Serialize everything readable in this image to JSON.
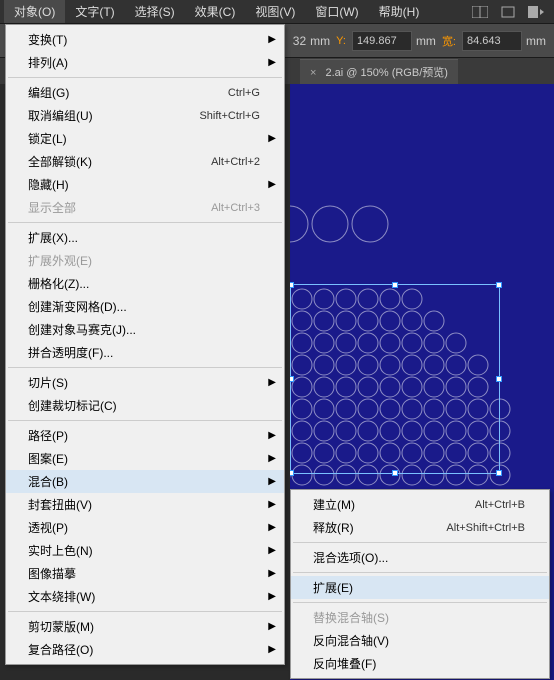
{
  "menubar": {
    "items": [
      "对象(O)",
      "文字(T)",
      "选择(S)",
      "效果(C)",
      "视图(V)",
      "窗口(W)",
      "帮助(H)"
    ]
  },
  "toolbar": {
    "x_value": "32",
    "x_unit": "mm",
    "y_label": "Y:",
    "y_value": "149.867",
    "y_unit": "mm",
    "w_label": "宽:",
    "w_value": "84.643",
    "w_unit": "mm"
  },
  "tab": {
    "close": "×",
    "title": "2.ai @ 150% (RGB/预览)"
  },
  "menu": {
    "items": [
      {
        "label": "变换(T)",
        "sub": true
      },
      {
        "label": "排列(A)",
        "sub": true
      },
      {
        "sep": true
      },
      {
        "label": "编组(G)",
        "shortcut": "Ctrl+G"
      },
      {
        "label": "取消编组(U)",
        "shortcut": "Shift+Ctrl+G"
      },
      {
        "label": "锁定(L)",
        "sub": true
      },
      {
        "label": "全部解锁(K)",
        "shortcut": "Alt+Ctrl+2"
      },
      {
        "label": "隐藏(H)",
        "sub": true
      },
      {
        "label": "显示全部",
        "shortcut": "Alt+Ctrl+3",
        "disabled": true
      },
      {
        "sep": true
      },
      {
        "label": "扩展(X)..."
      },
      {
        "label": "扩展外观(E)",
        "disabled": true
      },
      {
        "label": "栅格化(Z)..."
      },
      {
        "label": "创建渐变网格(D)..."
      },
      {
        "label": "创建对象马赛克(J)..."
      },
      {
        "label": "拼合透明度(F)..."
      },
      {
        "sep": true
      },
      {
        "label": "切片(S)",
        "sub": true
      },
      {
        "label": "创建裁切标记(C)"
      },
      {
        "sep": true
      },
      {
        "label": "路径(P)",
        "sub": true
      },
      {
        "label": "图案(E)",
        "sub": true
      },
      {
        "label": "混合(B)",
        "sub": true,
        "hl": true
      },
      {
        "label": "封套扭曲(V)",
        "sub": true
      },
      {
        "label": "透视(P)",
        "sub": true
      },
      {
        "label": "实时上色(N)",
        "sub": true
      },
      {
        "label": "图像描摹",
        "sub": true
      },
      {
        "label": "文本绕排(W)",
        "sub": true
      },
      {
        "sep": true
      },
      {
        "label": "剪切蒙版(M)",
        "sub": true
      },
      {
        "label": "复合路径(O)",
        "sub": true
      }
    ]
  },
  "submenu": {
    "items": [
      {
        "label": "建立(M)",
        "shortcut": "Alt+Ctrl+B"
      },
      {
        "label": "释放(R)",
        "shortcut": "Alt+Shift+Ctrl+B"
      },
      {
        "sep": true
      },
      {
        "label": "混合选项(O)..."
      },
      {
        "sep": true
      },
      {
        "label": "扩展(E)",
        "hl": true
      },
      {
        "sep": true
      },
      {
        "label": "替换混合轴(S)",
        "disabled": true
      },
      {
        "label": "反向混合轴(V)"
      },
      {
        "label": "反向堆叠(F)"
      }
    ]
  }
}
